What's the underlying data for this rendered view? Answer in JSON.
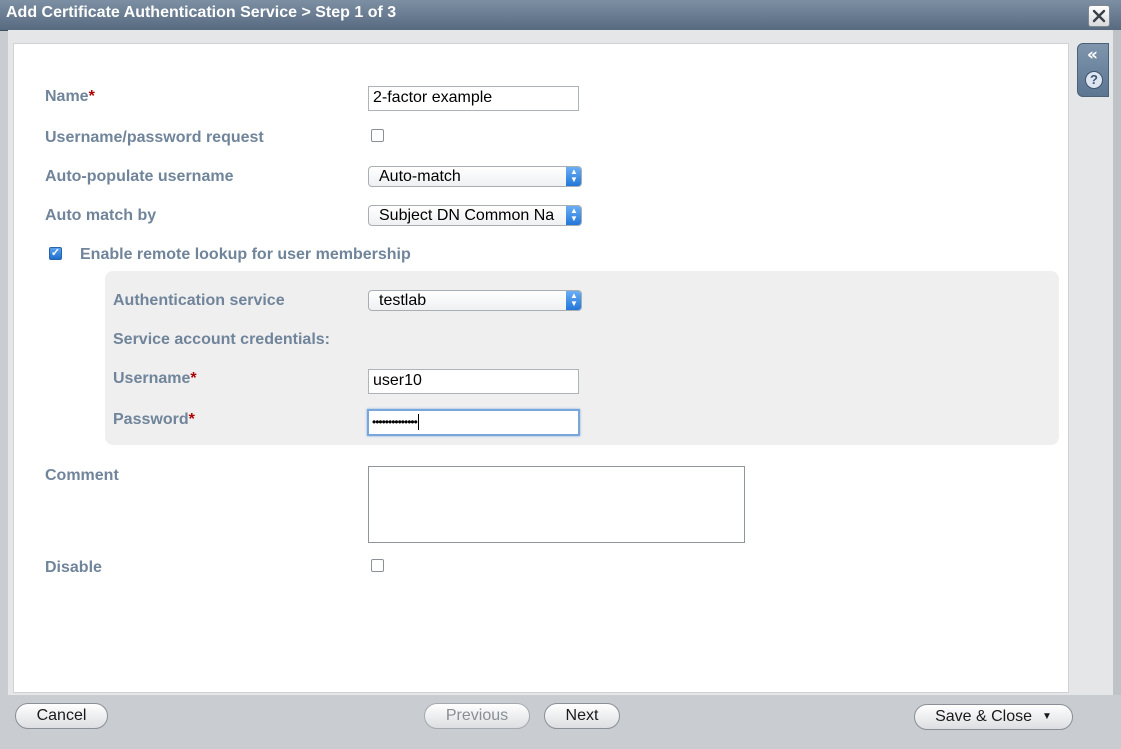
{
  "window": {
    "title": "Add Certificate Authentication Service > Step 1 of 3",
    "close_label": "✕"
  },
  "side_panel": {
    "collapse_icon": "«",
    "help_icon": "?"
  },
  "form": {
    "name": {
      "label": "Name",
      "required_mark": "*",
      "value": "2-factor example"
    },
    "username_password_request": {
      "label": "Username/password request",
      "checked": false
    },
    "auto_populate_username": {
      "label": "Auto-populate username",
      "selected": "Auto-match"
    },
    "auto_match_by": {
      "label": "Auto match by",
      "selected": "Subject DN Common Na"
    },
    "enable_remote_lookup": {
      "label": "Enable remote lookup for user membership",
      "checked": true
    },
    "authentication_service": {
      "label": "Authentication service",
      "selected": "testlab"
    },
    "service_account_credentials": {
      "label": "Service account credentials:"
    },
    "username": {
      "label": "Username",
      "required_mark": "*",
      "value": "user10"
    },
    "password": {
      "label": "Password",
      "required_mark": "*",
      "value": "••••••••••••••"
    },
    "comment": {
      "label": "Comment",
      "value": ""
    },
    "disable": {
      "label": "Disable",
      "checked": false
    }
  },
  "footer": {
    "cancel_label": "Cancel",
    "previous_label": "Previous",
    "next_label": "Next",
    "save_close_label": "Save & Close",
    "save_close_arrow": "▼"
  },
  "colors": {
    "label": "#70849a",
    "required": "#b00000",
    "titlebar": "#576a80",
    "select_arrow": "#1f74d8"
  }
}
